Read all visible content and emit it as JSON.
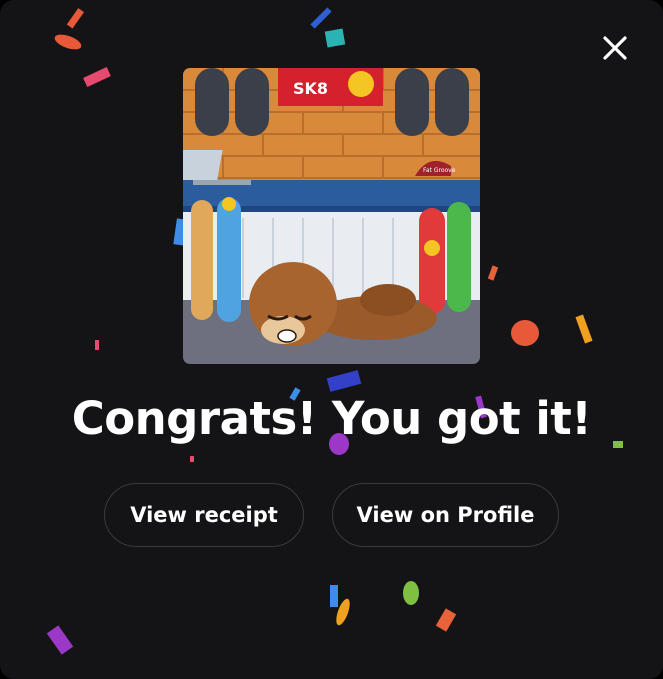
{
  "modal": {
    "headline": "Congrats! You got it!",
    "buttons": {
      "receipt": "View receipt",
      "profile": "View on Profile"
    },
    "icons": {
      "close": "close-icon"
    },
    "artwork": {
      "sign_text": "SK8",
      "cap_text": "Fat Groove"
    },
    "colors": {
      "background": "#141416",
      "button_border": "#3a3a3d",
      "text": "#ffffff"
    }
  }
}
